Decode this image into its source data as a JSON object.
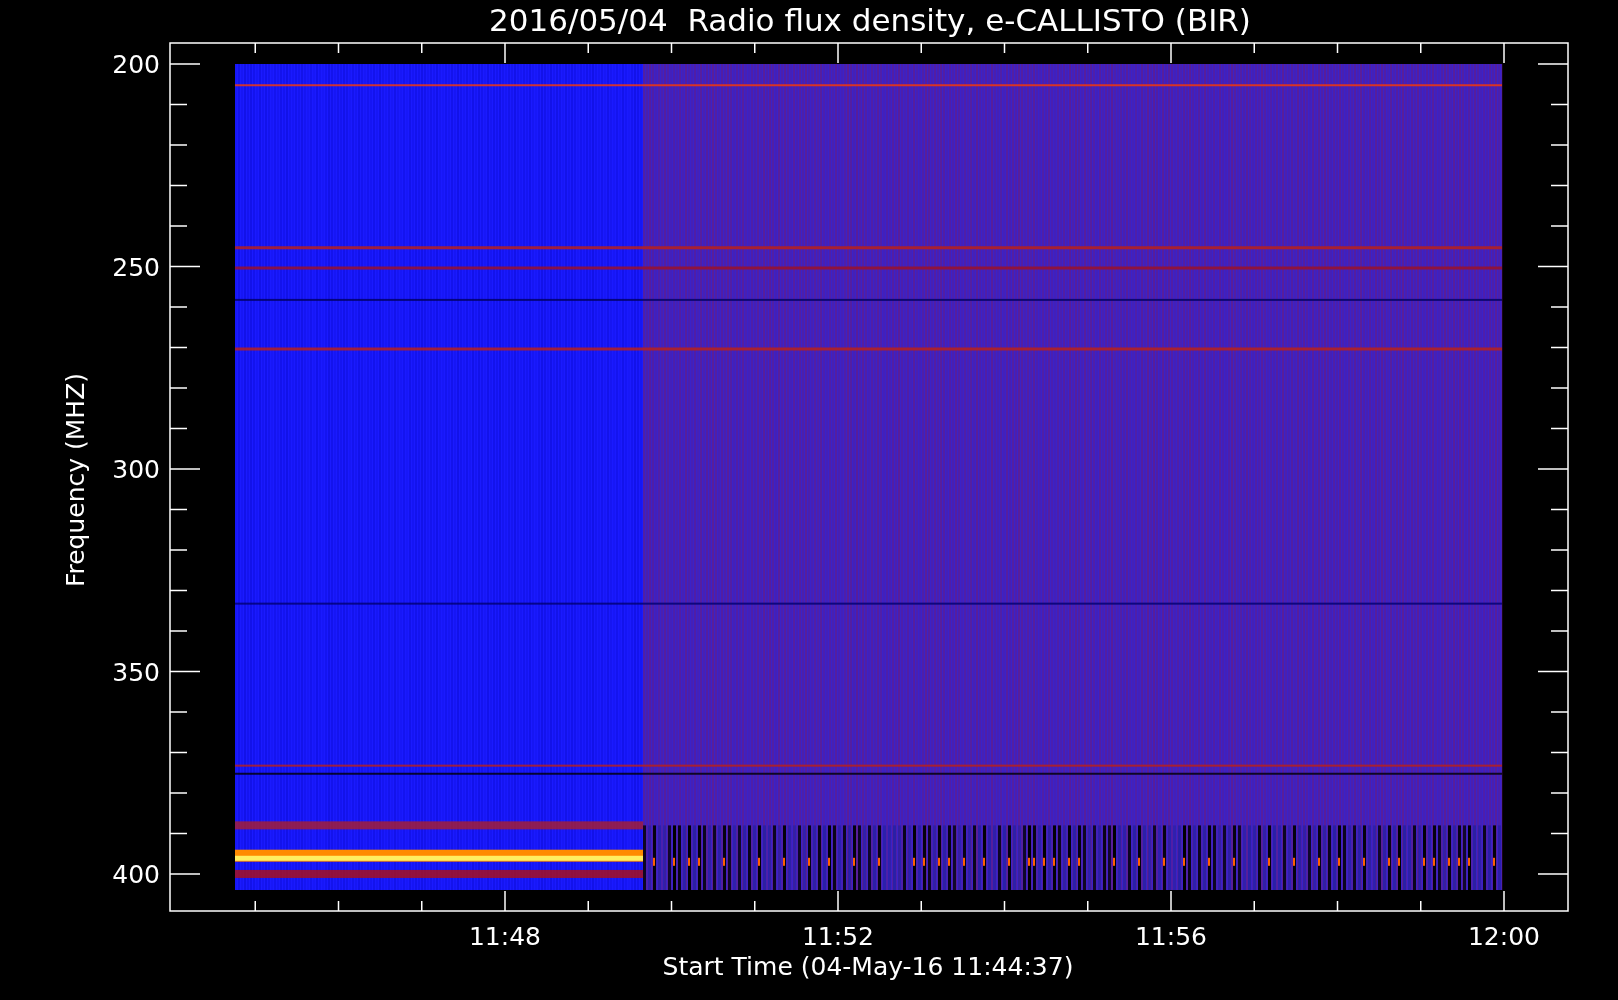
{
  "title": "2016/05/04  Radio flux density, e-CALLISTO (BIR)",
  "y_axis": {
    "label": "Frequency (MHZ)",
    "ticks": [
      "200",
      "250",
      "300",
      "350",
      "400"
    ]
  },
  "x_axis": {
    "label": "Start Time (04-May-16 11:44:37)",
    "ticks": [
      "11:48",
      "11:52",
      "11:56",
      "12:00"
    ]
  }
}
